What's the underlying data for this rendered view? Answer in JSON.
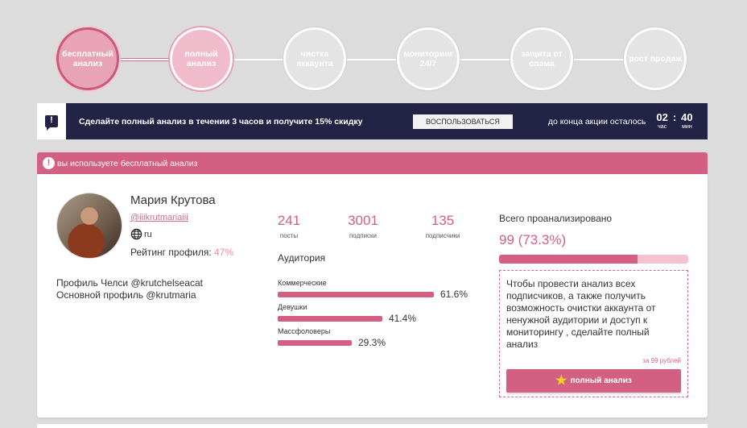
{
  "steps": [
    {
      "label": "бесплатный анализ"
    },
    {
      "label": "полный анализ"
    },
    {
      "label": "чистка аккаунта"
    },
    {
      "label": "мониторинг 24/7"
    },
    {
      "label": "защита от спама"
    },
    {
      "label": "рост продаж"
    }
  ],
  "promo": {
    "icon": "alert-message-icon",
    "text": "Сделайте полный анализ в течении 3 часов и получите 15% скидку",
    "button": "ВОСПОЛЬЗОВАТЬСЯ",
    "countdown_label": "до конца акции осталось",
    "hours": "02",
    "hours_unit": "час",
    "separator": ":",
    "minutes": "40",
    "minutes_unit": "мин"
  },
  "notice": {
    "icon_text": "!",
    "text": "вы используете бесплатный анализ"
  },
  "profile": {
    "name": "Мария Крутова",
    "handle": "@iiikrutmariaiii",
    "language": "ru",
    "rating_label": "Рейтинг профиля:",
    "rating_value": "47%",
    "line1": "Профиль Челси @krutchelseacat",
    "line2": "Основной профиль @krutmaria"
  },
  "stats": [
    {
      "value": "241",
      "label": "посты"
    },
    {
      "value": "3001",
      "label": "подписки"
    },
    {
      "value": "135",
      "label": "подписчики"
    }
  ],
  "audience": {
    "title": "Аудитория",
    "items": [
      {
        "label": "Коммерческие",
        "percent": "61.6%",
        "fraction": 0.616
      },
      {
        "label": "Девушки",
        "percent": "41.4%",
        "fraction": 0.414
      },
      {
        "label": "Массфоловеры",
        "percent": "29.3%",
        "fraction": 0.293
      }
    ]
  },
  "analysis": {
    "title": "Всего проанализировано",
    "value": "99 (73.3%)",
    "fraction": 0.733,
    "info_text": "Чтобы провести анализ всех подписчиков, а также получить возможность очистки аккаунта от ненужной аудитории и доступ к мониторингу , сделайте полный анализ",
    "price": "за 99 рублей",
    "button": "полный анализ"
  },
  "colors": {
    "accent": "#d35f82",
    "promo_bg": "#232345"
  }
}
